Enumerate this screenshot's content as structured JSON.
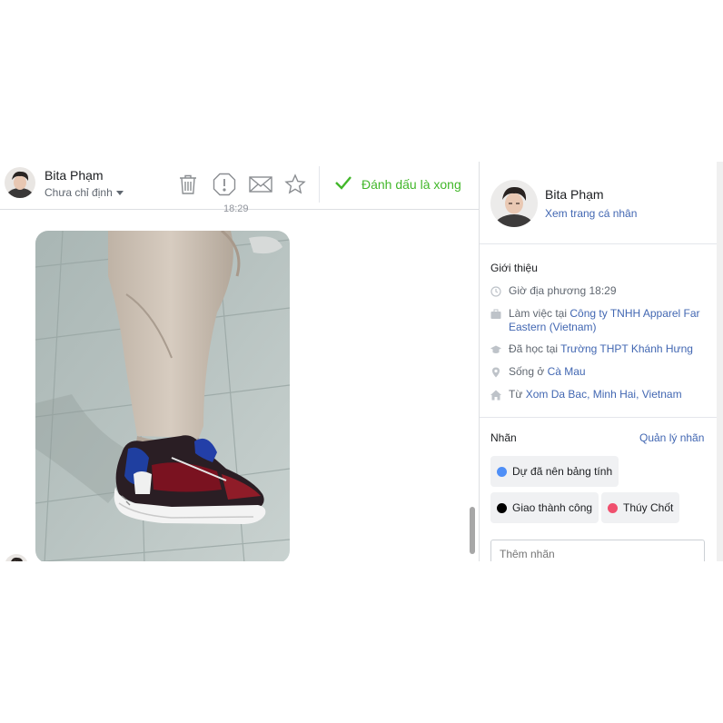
{
  "conversation": {
    "contact_name": "Bita Phạm",
    "assignee": "Chưa chỉ định",
    "mark_done_label": "Đánh dấu là xong",
    "timestamp": "18:29",
    "toolbar_icons": [
      "trash-icon",
      "alert-icon",
      "mail-icon",
      "star-icon"
    ],
    "accent_color": "#42b72a"
  },
  "profile": {
    "name": "Bita Phạm",
    "view_profile": "Xem trang cá nhân",
    "intro_title": "Giới thiệu",
    "local_time": "Giờ địa phương 18:29",
    "work_prefix": "Làm việc tại",
    "work_link": "Công ty TNHH Apparel Far Eastern (Vietnam)",
    "study_prefix": "Đã học tại",
    "study_link": "Trường THPT Khánh Hưng",
    "lives_prefix": "Sống ở",
    "lives_link": "Cà Mau",
    "from_prefix": "Từ",
    "from_link": "Xom Da Bac, Minh Hai, Vietnam",
    "link_color": "#4267b2"
  },
  "labels": {
    "title": "Nhãn",
    "manage": "Quản lý nhãn",
    "items": [
      {
        "text": "Dự đã nên bảng tính",
        "color": "#4f8ff7"
      },
      {
        "text": "Giao thành công",
        "color": "#000000"
      },
      {
        "text": "Thúy Chốt",
        "color": "#f0506e"
      }
    ],
    "add_placeholder": "Thêm nhãn"
  }
}
